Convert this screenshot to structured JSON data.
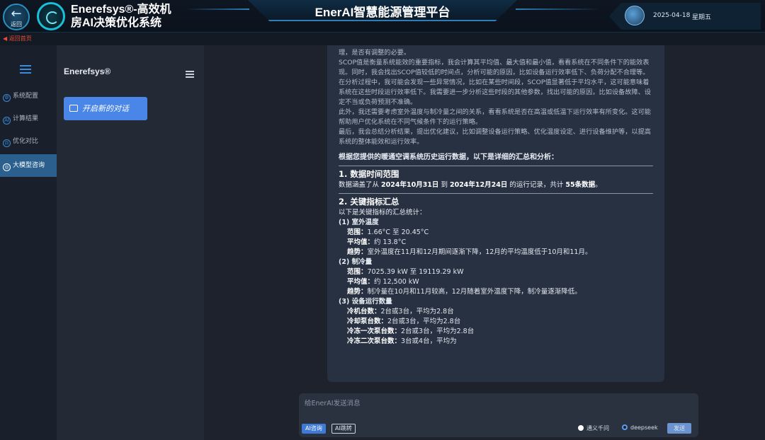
{
  "header": {
    "back_label": "返回",
    "app_title_line1": "Enerefsys®-高效机",
    "app_title_line2": "房AI决策优化系统",
    "center_title": "EnerAI智慧能源管理平台",
    "date": "2025-04-18",
    "weekday": "星期五",
    "crumb": "◀ 返回首页"
  },
  "sidebar": {
    "items": [
      {
        "label": "系统配置",
        "icon": "⚙"
      },
      {
        "label": "计算结果",
        "icon": "AI"
      },
      {
        "label": "优化对比",
        "icon": "⚖"
      },
      {
        "label": "大模型咨询",
        "icon": "◎"
      }
    ]
  },
  "conversations": {
    "brand": "Enerefsys®",
    "new_chat": "开启新的对话"
  },
  "message": {
    "intro": [
      "理，是否有调整的必要。",
      "SCOP值是衡量系统能效的重要指标，我会计算其平均值、最大值和最小值，看看系统在不同条件下的能效表现。同时，我会找出SCOP值较低的时间点，分析可能的原因，比如设备运行效率低下、负荷分配不合理等。",
      "在分析过程中，我可能会发现一些异常情况，比如在某些时间段，SCOP值显著低于平均水平，这可能意味着系统在这些时段运行效率低下。我需要进一步分析这些时段的其他参数，找出可能的原因，比如设备故障、设定不当或负荷预测不准确。",
      "此外，我还需要考虑室外温度与制冷量之间的关系，看看系统是否在高温或低温下运行效率有所变化。这可能帮助用户优化系统在不同气候条件下的运行策略。",
      "最后，我会总结分析结果，提出优化建议，比如调整设备运行策略、优化温度设定、进行设备维护等，以提高系统的整体能效和运行效率。"
    ],
    "lead": "根据您提供的暖通空调系统历史运行数据，以下是详细的汇总和分析：",
    "s1_title": "1. 数据时间范围",
    "s1_a": "数据涵盖了从 ",
    "s1_d1": "2024年10月31日",
    "s1_b": " 到 ",
    "s1_d2": "2024年12月24日",
    "s1_c": " 的运行记录，共计 ",
    "s1_n": "55条数据",
    "s1_e": "。",
    "s2_title": "2. 关键指标汇总",
    "s2_intro": "以下是关键指标的汇总统计：",
    "g1": "(1) 室外温度",
    "g1_l1_k": "范围：",
    "g1_l1_v": "1.66°C 至 20.45°C",
    "g1_l2_k": "平均值：",
    "g1_l2_v": "约 13.8°C",
    "g1_l3_k": "趋势：",
    "g1_l3_v": "室外温度在11月和12月期间逐渐下降，12月的平均温度低于10月和11月。",
    "g2": "(2) 制冷量",
    "g2_l1_k": "范围：",
    "g2_l1_v": "7025.39 kW 至 19119.29 kW",
    "g2_l2_k": "平均值：",
    "g2_l2_v": "约 12,500 kW",
    "g2_l3_k": "趋势：",
    "g2_l3_v": "制冷量在10月和11月较高，12月随着室外温度下降，制冷量逐渐降低。",
    "g3": "(3) 设备运行数量",
    "g3_l1_k": "冷机台数：",
    "g3_l1_v": "2台或3台，平均为2.8台",
    "g3_l2_k": "冷却泵台数：",
    "g3_l2_v": "2台或3台，平均为2.8台",
    "g3_l3_k": "冷冻一次泵台数：",
    "g3_l3_v": "2台或3台，平均为2.8台",
    "g3_l4_k": "冷冻二次泵台数：",
    "g3_l4_v": "3台或4台，平均为"
  },
  "input": {
    "placeholder": "给EnerAI发送消息",
    "chip_a": "AI咨询",
    "chip_b": "AI跳转",
    "radio1": "通义千问",
    "radio2": "deepseek",
    "send": "发送"
  }
}
